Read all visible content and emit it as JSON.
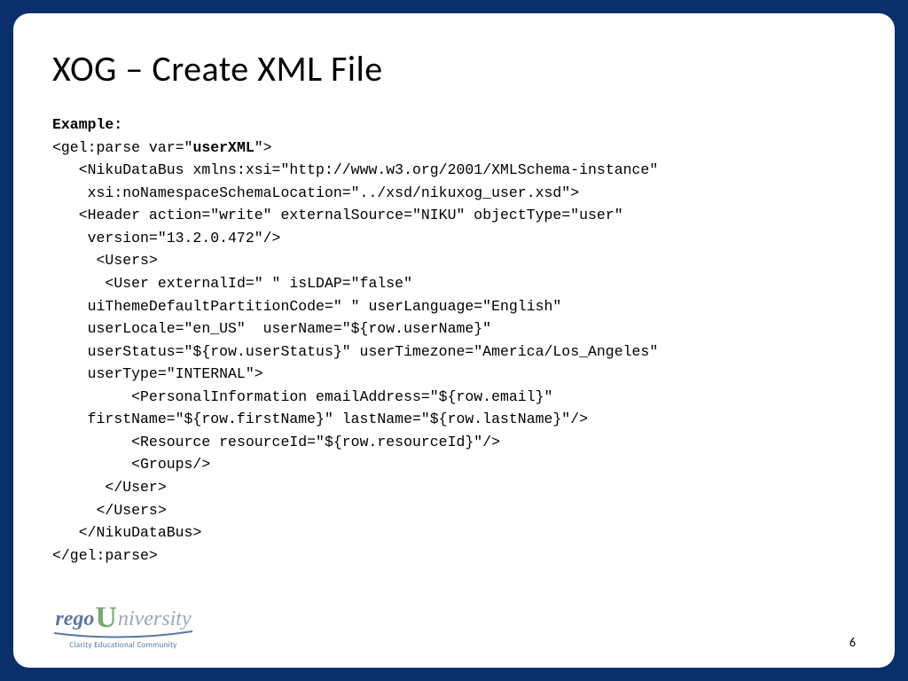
{
  "slide": {
    "title": "XOG – Create XML File",
    "example_label": "Example:",
    "code": {
      "line01_a": "<gel:parse var=\"",
      "line01_b": "userXML",
      "line01_c": "\">",
      "line02": "   <NikuDataBus xmlns:xsi=\"http://www.w3.org/2001/XMLSchema-instance\"",
      "line03": "    xsi:noNamespaceSchemaLocation=\"../xsd/nikuxog_user.xsd\">",
      "line04": "   <Header action=\"write\" externalSource=\"NIKU\" objectType=\"user\"",
      "line05": "    version=\"13.2.0.472\"/>",
      "line06": "     <Users>",
      "line07": "      <User externalId=\" \" isLDAP=\"false\"",
      "line08": "    uiThemeDefaultPartitionCode=\" \" userLanguage=\"English\"",
      "line09": "    userLocale=\"en_US\"  userName=\"${row.userName}\"",
      "line10": "    userStatus=\"${row.userStatus}\" userTimezone=\"America/Los_Angeles\"",
      "line11": "    userType=\"INTERNAL\">",
      "line12": "         <PersonalInformation emailAddress=\"${row.email}\"",
      "line13": "    firstName=\"${row.firstName}\" lastName=\"${row.lastName}\"/>",
      "line14": "         <Resource resourceId=\"${row.resourceId}\"/>",
      "line15": "         <Groups/>",
      "line16": "      </User>",
      "line17": "     </Users>",
      "line18": "   </NikuDataBus>",
      "line19": "</gel:parse>"
    },
    "page_number": "6",
    "logo": {
      "rego": "rego",
      "u": "U",
      "niv": "niversity",
      "tagline": "Clarity Educational Community"
    }
  }
}
